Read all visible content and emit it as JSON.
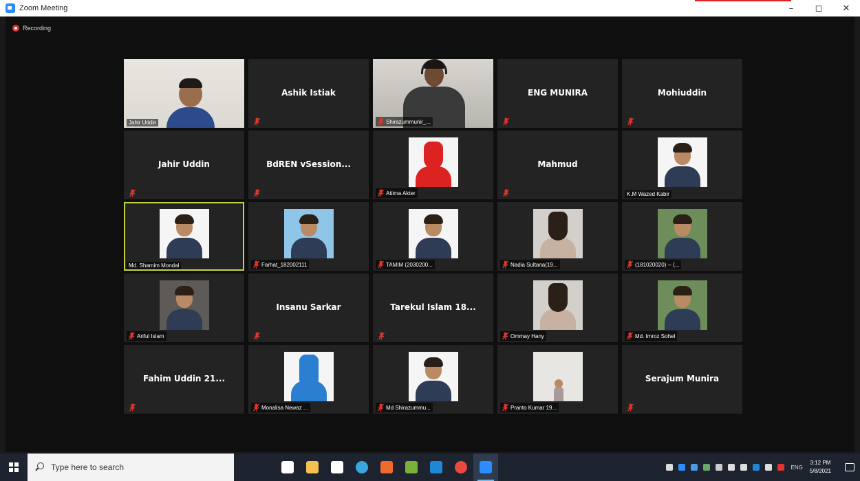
{
  "window": {
    "title": "Zoom Meeting",
    "controls": {
      "minimize": "–",
      "restore": "◻",
      "close": "✕"
    }
  },
  "recording": {
    "label": "Recording"
  },
  "participants": [
    {
      "name": "Jahir Uddin",
      "type": "video",
      "scene": "office",
      "label": "Jahir Uddin",
      "muted": false
    },
    {
      "name": "Ashik Istiak",
      "type": "name",
      "muted": true
    },
    {
      "name": "Shirazummunir_...",
      "type": "video",
      "scene": "suit",
      "label": "Shirazummunir_...",
      "muted": true
    },
    {
      "name": "ENG MUNIRA",
      "type": "name",
      "muted": true
    },
    {
      "name": "Mohiuddin",
      "type": "name",
      "muted": true
    },
    {
      "name": "Jahir Uddin",
      "type": "name",
      "muted": true
    },
    {
      "name": "BdREN vSession...",
      "type": "name",
      "muted": true
    },
    {
      "name": "Atiima Akter",
      "type": "photo",
      "style": "red",
      "label": "Atiima Akter",
      "muted": true
    },
    {
      "name": "Mahmud",
      "type": "name",
      "muted": true
    },
    {
      "name": "K.M Wazed Kabir",
      "type": "photo",
      "style": "",
      "label": "K.M Wazed Kabir",
      "muted": false
    },
    {
      "name": "Md. Shamim Mondal",
      "type": "photo",
      "style": "",
      "label": "Md. Shamim Mondal",
      "muted": false,
      "active": true
    },
    {
      "name": "Farhat_182002111",
      "type": "photo",
      "style": "blue",
      "label": "Farhat_182002111",
      "muted": true
    },
    {
      "name": "TAMIM (2030200...",
      "type": "photo",
      "style": "",
      "label": "TAMIM (2030200...",
      "muted": true
    },
    {
      "name": "Nadia Sultana(19...",
      "type": "photo",
      "style": "girl",
      "label": "Nadia Sultana(19...",
      "muted": true
    },
    {
      "name": "(181020020) -- (...",
      "type": "photo",
      "style": "nature",
      "label": "(181020020) -- (...",
      "muted": true
    },
    {
      "name": "Ariful Islam",
      "type": "photo",
      "style": "dark",
      "label": "Ariful Islam",
      "muted": true
    },
    {
      "name": "Insanu Sarkar",
      "type": "name",
      "muted": true
    },
    {
      "name": "Tarekul Islam 18...",
      "type": "name",
      "muted": true
    },
    {
      "name": "Ommay Hany",
      "type": "photo",
      "style": "girl",
      "label": "Ommay Hany",
      "muted": true
    },
    {
      "name": "Md. Imroz Sohel",
      "type": "photo",
      "style": "nature",
      "label": "Md. Imroz Sohel",
      "muted": true
    },
    {
      "name": "Fahim Uddin 21...",
      "type": "name",
      "muted": true
    },
    {
      "name": "Monalisa Newaz ...",
      "type": "photo",
      "style": "blueveil",
      "label": "Monalisa Newaz ...",
      "muted": true
    },
    {
      "name": "Md Shirazummu...",
      "type": "photo",
      "style": "",
      "label": "Md Shirazummu...",
      "muted": true
    },
    {
      "name": "Pranto Kumar 19...",
      "type": "photo",
      "style": "tree",
      "label": "Pranto Kumar 19...",
      "muted": true
    },
    {
      "name": "Serajum Munira",
      "type": "name",
      "muted": true
    }
  ],
  "colors": {
    "active_speaker_border": "#c6d43d",
    "mute_icon": "#e0342c",
    "zoom_blue": "#2d8cff"
  },
  "taskbar": {
    "search_placeholder": "Type here to search",
    "apps": [
      {
        "icon": "task-view-icon",
        "color": "#ffffff"
      },
      {
        "icon": "file-explorer-icon",
        "color": "#f2c14e"
      },
      {
        "icon": "store-icon",
        "color": "#ffffff"
      },
      {
        "icon": "edge-icon",
        "color": "#3aa6e0"
      },
      {
        "icon": "app-icon",
        "color": "#f06a2c"
      },
      {
        "icon": "app-icon",
        "color": "#7bb13b"
      },
      {
        "icon": "mail-icon",
        "color": "#1e88d6"
      },
      {
        "icon": "chrome-icon",
        "color": "#e84b3c"
      },
      {
        "icon": "zoom-icon",
        "color": "#2d8cff",
        "active": true
      }
    ],
    "language": "ENG",
    "time": "3:12 PM",
    "date": "5/8/2021"
  }
}
